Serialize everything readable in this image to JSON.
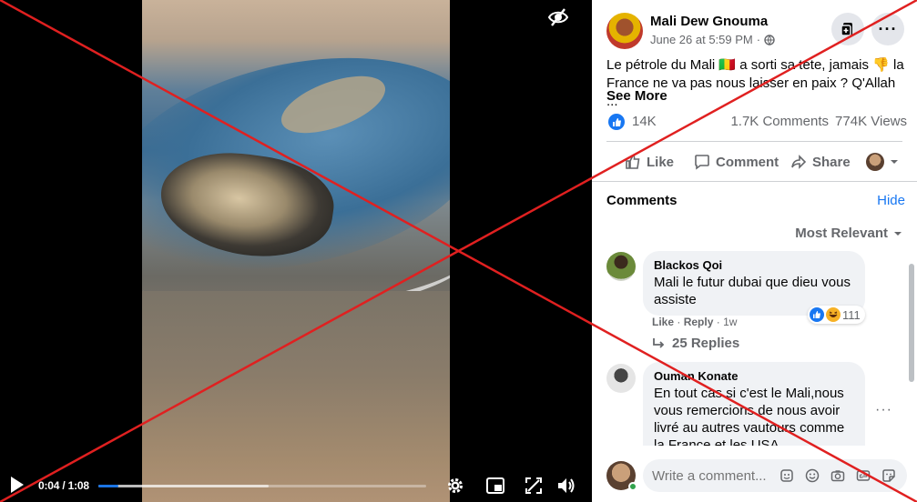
{
  "video": {
    "time": "0:04 / 1:08",
    "progress": 0.06,
    "buffered": 0.52
  },
  "post": {
    "author": "Mali Dew Gnouma",
    "date": "June 26 at 5:59 PM",
    "text": "Le pétrole du Mali 🇲🇱 a sorti sa tete, jamais 👎 la France ne va pas nous laisser en paix ? Q'Allah ...",
    "see_more": "See More",
    "likes": "14K",
    "comments_count": "1.7K Comments",
    "views_count": "774K Views"
  },
  "actions": {
    "like": "Like",
    "comment": "Comment",
    "share": "Share"
  },
  "comments_section": {
    "title": "Comments",
    "hide": "Hide",
    "sort": "Most Relevant"
  },
  "comments": [
    {
      "name": "Blackos Qoi",
      "text": "Mali le futur dubai que dieu vous assiste",
      "like": "Like",
      "reply": "Reply",
      "age": "1w",
      "reactions": "111",
      "replies": "25 Replies"
    },
    {
      "name": "Ouman Konate",
      "text": "En tout cas si c'est le Mali,nous vous remercions de nous avoir livré au autres vautours comme la France et les USA"
    }
  ],
  "composer": {
    "placeholder": "Write a comment..."
  },
  "colors": {
    "accent": "#1877f2",
    "overlay_x": "#e02020"
  }
}
